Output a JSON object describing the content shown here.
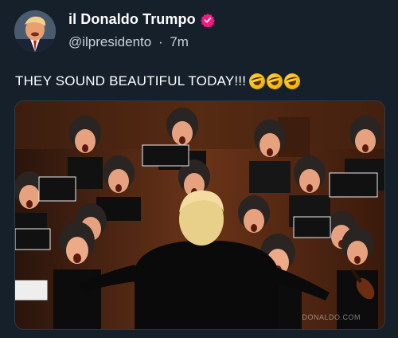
{
  "author": {
    "display_name": "il Donaldo Trumpo",
    "handle": "@ilpresidento",
    "separator": "·",
    "time": "7m",
    "verified_icon": "verified-badge-icon",
    "verified_color": "#f91880"
  },
  "post": {
    "text": "THEY SOUND BEAUTIFUL TODAY!!!",
    "emojis": [
      "rolling-on-floor-laughing",
      "rolling-on-floor-laughing",
      "rolling-on-floor-laughing"
    ]
  },
  "media": {
    "watermark": "DONALDO.COM"
  },
  "colors": {
    "background": "#15202b",
    "text": "#ffffff",
    "secondary_text": "#c9d1d9"
  }
}
